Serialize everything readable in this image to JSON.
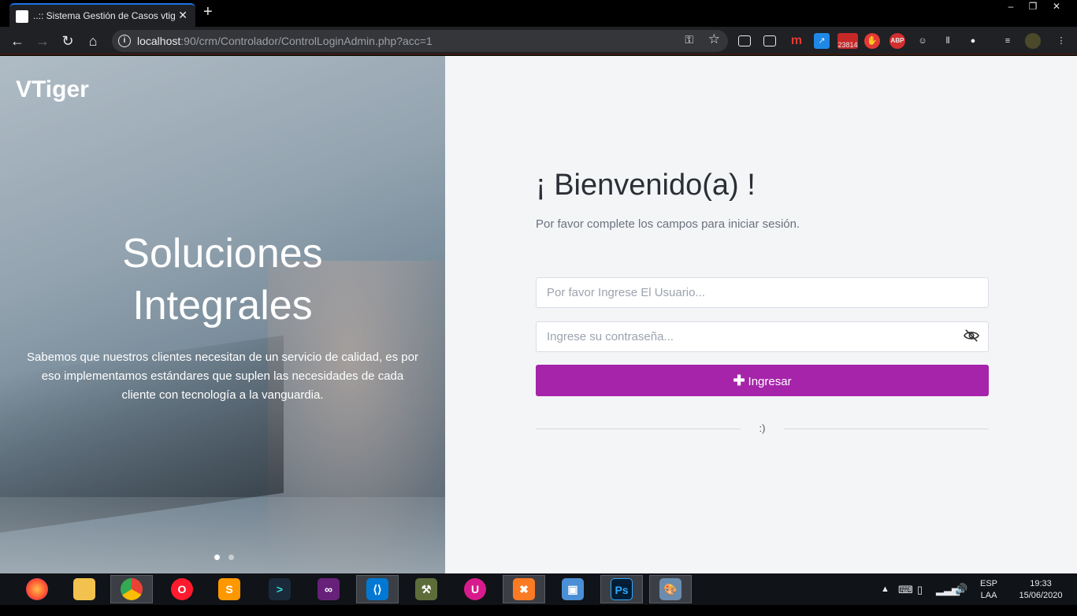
{
  "browser": {
    "tab_title": "..:: Sistema Gestión de Casos vtiger",
    "tab_close": "✕",
    "new_tab": "+",
    "url_host": "localhost",
    "url_rest": ":90/crm/Controlador/ControlLoginAdmin.php?acc=1",
    "badge_count": "23814",
    "window_controls": {
      "minimize": "–",
      "restore": "❐",
      "close": "✕"
    }
  },
  "hero": {
    "brand": "VTiger",
    "title_line1": "Soluciones",
    "title_line2": "Integrales",
    "text": "Sabemos que nuestros clientes necesitan de un servicio de calidad, es por eso implementamos estándares que suplen las necesidades de cada cliente con tecnología a la vanguardia.",
    "slides": 2,
    "active_slide": 1
  },
  "login": {
    "welcome": "¡ Bienvenido(a) !",
    "subtitle": "Por favor complete los campos para iniciar sesión.",
    "user_placeholder": "Por favor Ingrese El Usuario...",
    "user_value": "",
    "password_placeholder": "Ingrese su contraseña...",
    "password_value": "",
    "submit_label": "Ingresar",
    "divider_text": ":)"
  },
  "taskbar": {
    "apps": [
      "Firefox",
      "File Explorer",
      "Chrome",
      "Opera",
      "Sublime Text",
      "Terminal",
      "Visual Studio",
      "VS Code",
      "Settings",
      "Plugin",
      "XAMPP",
      "VirtualBox",
      "Photoshop",
      "Paint"
    ],
    "active_app": "Chrome",
    "language": "ESP",
    "layout": "LAA",
    "time": "19:33",
    "date": "15/06/2020"
  },
  "colors": {
    "accent": "#a524a9",
    "tab_highlight": "#1a73e8",
    "page_bg": "#f4f5f7"
  }
}
